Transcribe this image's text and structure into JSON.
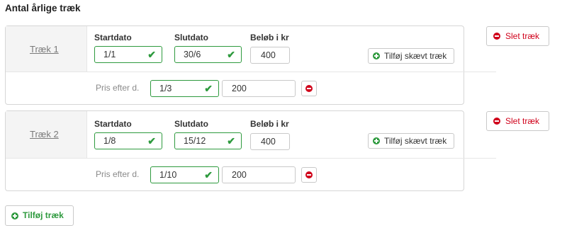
{
  "page": {
    "title": "Antal årlige træk"
  },
  "labels": {
    "start": "Startdato",
    "end": "Slutdato",
    "amount": "Beløb i kr",
    "price_after": "Pris efter d."
  },
  "buttons": {
    "add_skewed": "Tilføj skævt træk",
    "delete": "Slet træk",
    "add": "Tilføj træk"
  },
  "icons": {
    "add": "plus-circle-icon",
    "remove": "minus-circle-icon",
    "valid": "check-icon"
  },
  "colors": {
    "valid": "#2e9a3e",
    "danger": "#d0021b"
  },
  "treks": [
    {
      "name": "Træk 1",
      "start": "1/1",
      "end": "30/6",
      "amount": "400",
      "price_date": "1/3",
      "price_amount": "200"
    },
    {
      "name": "Træk 2",
      "start": "1/8",
      "end": "15/12",
      "amount": "400",
      "price_date": "1/10",
      "price_amount": "200"
    }
  ]
}
